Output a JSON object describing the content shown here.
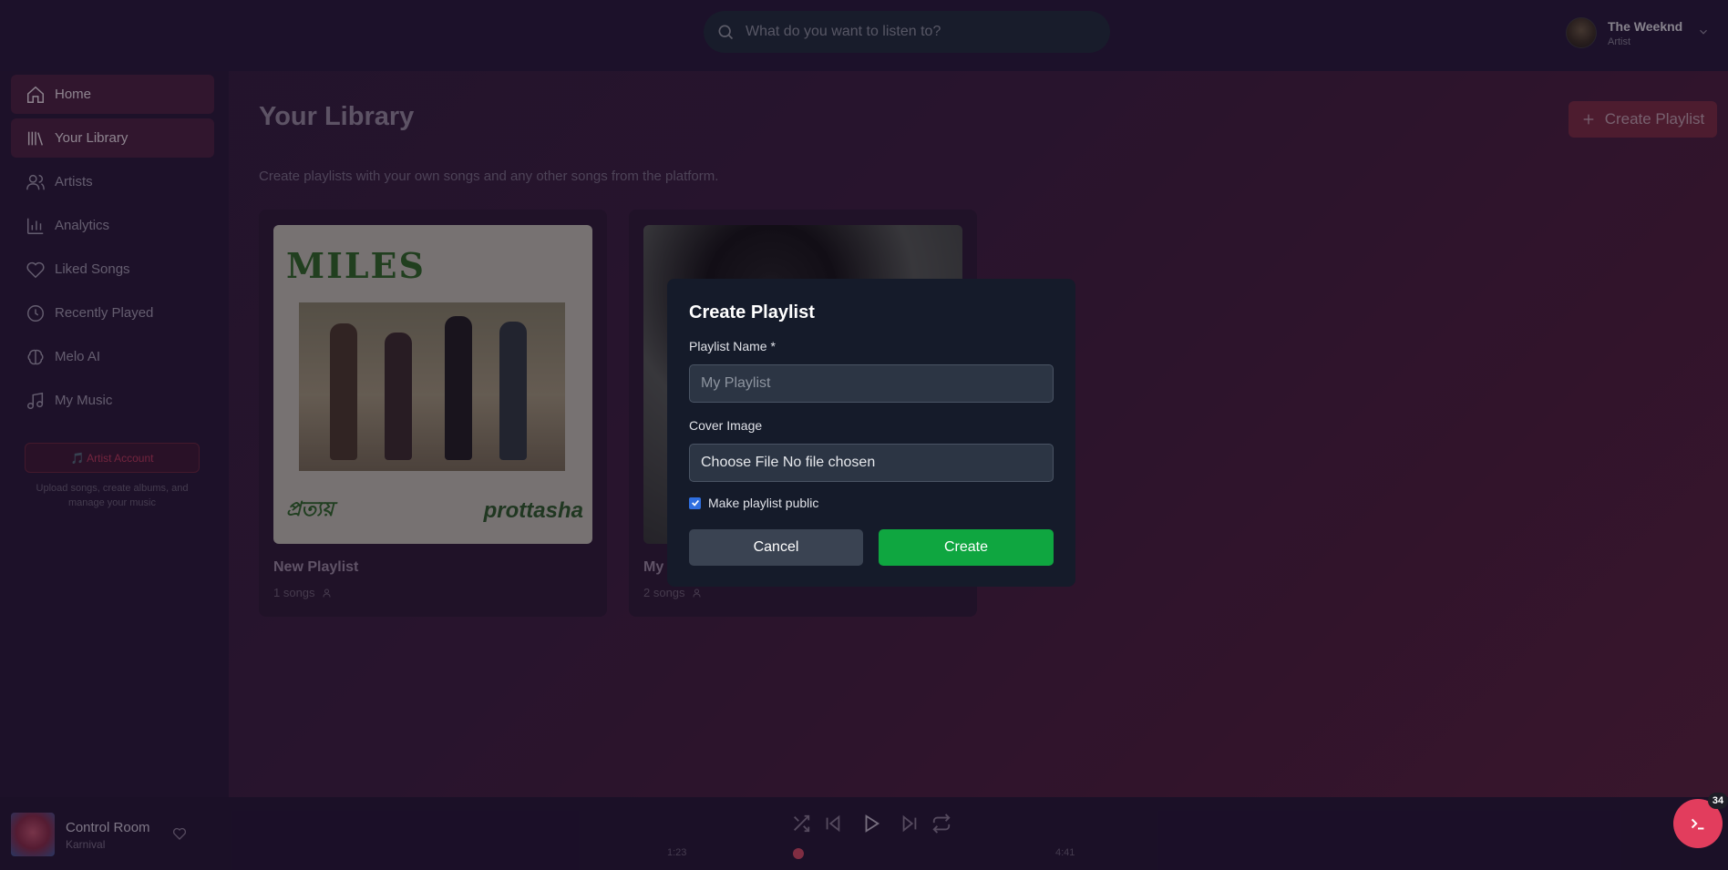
{
  "header": {
    "search_placeholder": "What do you want to listen to?",
    "user_name": "The Weeknd",
    "user_role": "Artist"
  },
  "sidebar": {
    "items": [
      {
        "label": "Home",
        "icon": "home-icon"
      },
      {
        "label": "Your Library",
        "icon": "library-icon"
      },
      {
        "label": "Artists",
        "icon": "users-icon"
      },
      {
        "label": "Analytics",
        "icon": "chart-icon"
      },
      {
        "label": "Liked Songs",
        "icon": "heart-icon"
      },
      {
        "label": "Recently Played",
        "icon": "clock-icon"
      },
      {
        "label": "Melo AI",
        "icon": "brain-icon"
      },
      {
        "label": "My Music",
        "icon": "music-icon"
      }
    ],
    "artist_button": "🎵 Artist Account",
    "artist_note": "Upload songs, create albums, and manage your music"
  },
  "main": {
    "title": "Your Library",
    "subtitle": "Create playlists with your own songs and any other songs from the platform.",
    "create_button": "Create Playlist",
    "cards": [
      {
        "title": "New Playlist",
        "meta": "1 songs",
        "cover_text_top": "MILES",
        "cover_text_left": "প্রত্যয়",
        "cover_text_right": "prottasha"
      },
      {
        "title": "My",
        "meta": "2 songs"
      }
    ]
  },
  "modal": {
    "title": "Create Playlist",
    "name_label": "Playlist Name *",
    "name_placeholder": "My Playlist",
    "cover_label": "Cover Image",
    "file_text": "Choose File No file chosen",
    "public_label": "Make playlist public",
    "public_checked": true,
    "cancel": "Cancel",
    "create": "Create"
  },
  "player": {
    "track": "Control Room",
    "artist": "Karnival",
    "elapsed": "1:23",
    "duration": "4:41"
  },
  "fab": {
    "badge": "34"
  },
  "colors": {
    "accent": "#e23d5d",
    "create_green": "#0fa640"
  }
}
